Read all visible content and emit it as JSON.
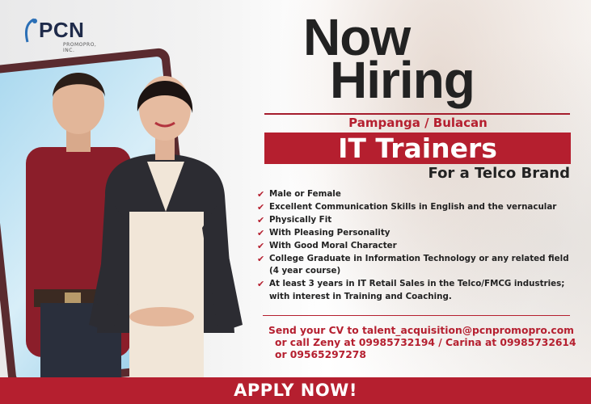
{
  "logo": {
    "brand": "PCN",
    "sub": "PROMOPRO, INC."
  },
  "headline": {
    "line1": "Now",
    "line2": "Hiring"
  },
  "location": "Pampanga / Bulacan",
  "position": "IT Trainers",
  "client": "For a Telco Brand",
  "requirements": [
    "Male or Female",
    "Excellent Communication Skills in English and the vernacular",
    "Physically Fit",
    "With Pleasing Personality",
    "With Good Moral Character",
    "College Graduate in Information Technology or any related field (4 year course)",
    "At least 3 years in IT Retail Sales in the Telco/FMCG industries; with interest in Training and Coaching."
  ],
  "contact": {
    "line1": "Send your CV to talent_acquisition@pcnpromopro.com",
    "line2": "or call  Zeny at 09985732194 / Carina at 09985732614",
    "line3": "or 09565297278"
  },
  "cta": "APPLY NOW!",
  "colors": {
    "accent": "#b51f2f",
    "text": "#222222",
    "brand": "#1f2b4a"
  },
  "icons": {
    "bullet": "check-icon"
  }
}
